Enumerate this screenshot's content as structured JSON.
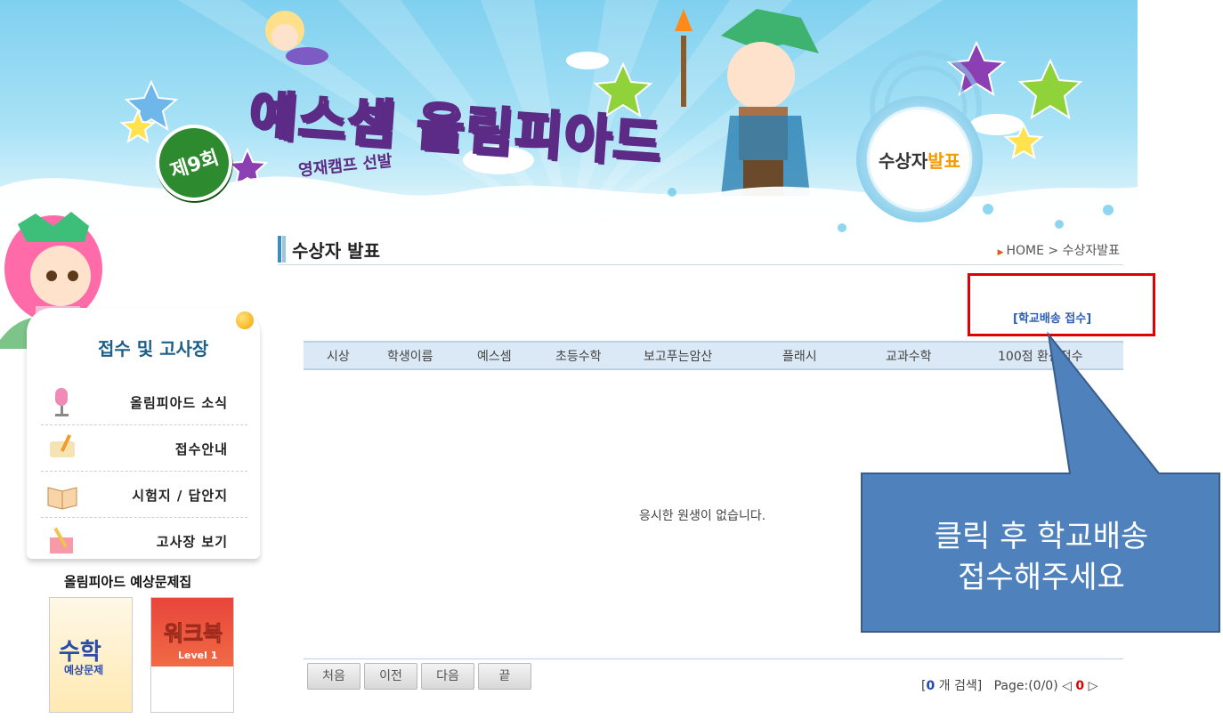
{
  "banner": {
    "logo_round": "제9회",
    "logo_main_a": "예스",
    "logo_main_b": "셈",
    "logo_main_c": " 올림피아드",
    "logo_sub": "영재캠프 선발",
    "award_label_a": "수상자",
    "award_label_b": "발표"
  },
  "sidebar": {
    "panel_title": "접수 및 고사장",
    "items": [
      {
        "label": "올림피아드 소식",
        "icon": "microphone-icon"
      },
      {
        "label": "접수안내",
        "icon": "scroll-icon"
      },
      {
        "label": "시험지 / 답안지",
        "icon": "open-book-icon"
      },
      {
        "label": "고사장 보기",
        "icon": "pencil-book-icon"
      }
    ],
    "books_title": "올림피아드 예상문제집",
    "book1_title": "수학",
    "book1_sub": "예상문제",
    "book2_title": "워크북",
    "book2_sub": "Level 1"
  },
  "main": {
    "page_title": "수상자 발표",
    "breadcrumb": "HOME > 수상자발표",
    "ship_link": "[학교배송 접수]",
    "columns": [
      "시상",
      "학생이름",
      "예스셈",
      "초등수학",
      "보고푸는암산",
      "플래시",
      "교과수학",
      "100점 환산점수"
    ],
    "empty_message": "응시한 원생이 없습니다.",
    "pagination": {
      "first": "처음",
      "prev": "이전",
      "next": "다음",
      "last": "끝"
    },
    "result": {
      "open_bracket": "[",
      "count": "0",
      "count_suffix": "개 검색]",
      "page_label": "Page:(0/0)",
      "left_arrow": "◁",
      "current": "0",
      "right_arrow": "▷"
    }
  },
  "callout": {
    "line1": "클릭 후 학교배송",
    "line2": "접수해주세요"
  },
  "colors": {
    "accent_blue": "#2b5fb3",
    "highlight_red": "#e00000",
    "callout_fill": "#4f81bd",
    "table_header": "#dbe9f6"
  }
}
